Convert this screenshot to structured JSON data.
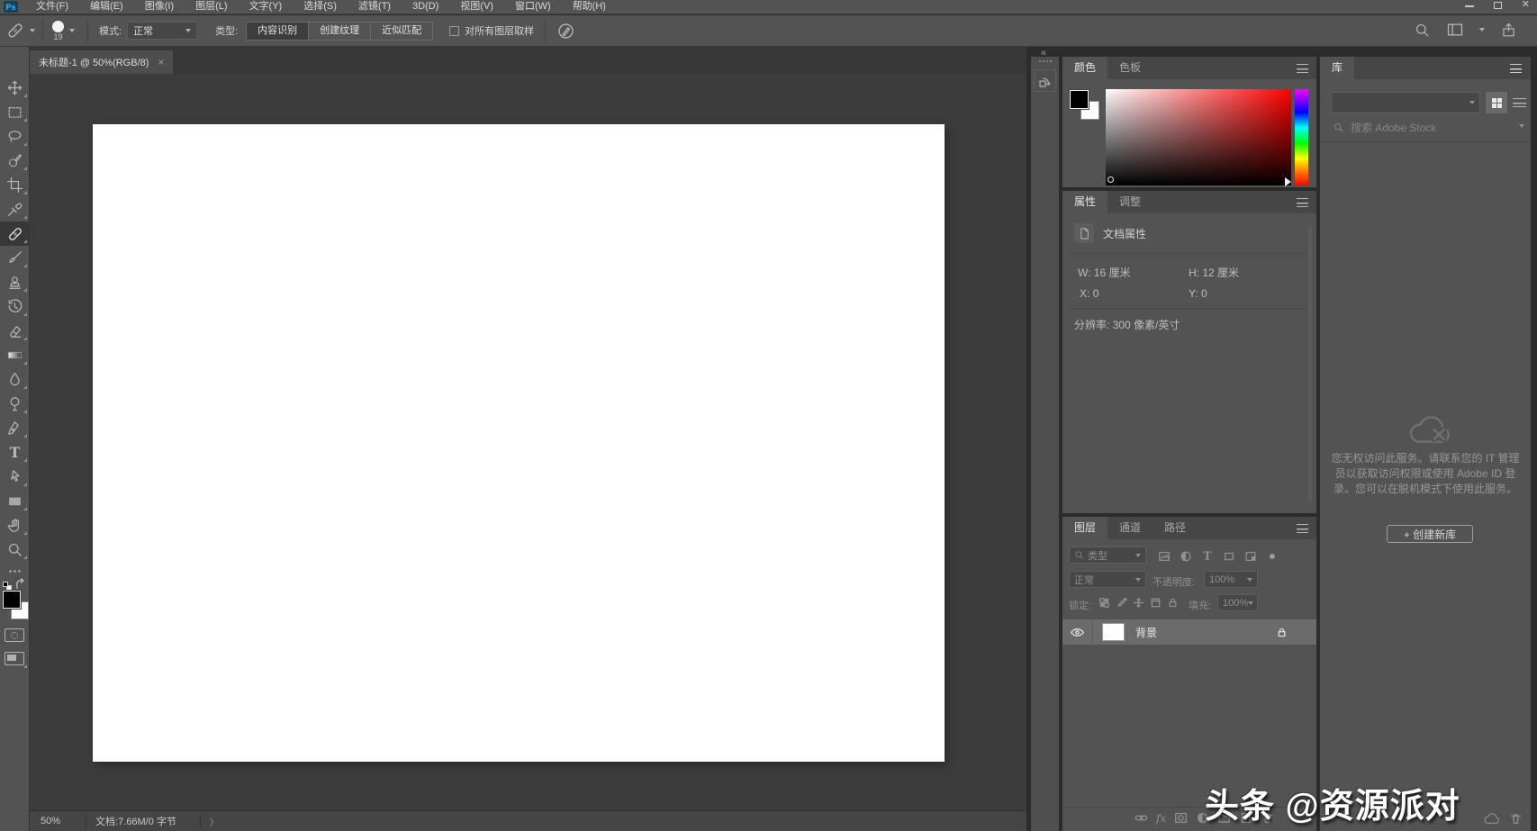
{
  "app": {
    "name": "Adobe Photoshop",
    "theme_colors": {
      "chrome": "#535353",
      "canvas_area": "#3c3c3c",
      "tab_strip": "#383838",
      "selected_layer": "#6b6b6b",
      "hue": "#ff0000",
      "logo_blue": "#4db3f0"
    }
  },
  "window_controls": [
    "minimize-button",
    "maximize-button",
    "close-button"
  ],
  "menu_bar": {
    "logo": "Ps",
    "items": [
      {
        "label": "文件(F)"
      },
      {
        "label": "编辑(E)"
      },
      {
        "label": "图像(I)"
      },
      {
        "label": "图层(L)"
      },
      {
        "label": "文字(Y)"
      },
      {
        "label": "选择(S)"
      },
      {
        "label": "滤镜(T)"
      },
      {
        "label": "3D(D)"
      },
      {
        "label": "视图(V)"
      },
      {
        "label": "窗口(W)"
      },
      {
        "label": "帮助(H)"
      }
    ]
  },
  "options_bar": {
    "tool_preset_icon": "spot-healing-brush-icon",
    "brush_size": "19",
    "mode_label": "模式:",
    "mode_value": "正常",
    "type_label": "类型:",
    "type_buttons": [
      {
        "label": "内容识别",
        "active": true
      },
      {
        "label": "创建纹理",
        "active": false
      },
      {
        "label": "近似匹配",
        "active": false
      }
    ],
    "sample_all_layers": {
      "checked": false,
      "label": "对所有图层取样"
    },
    "right_icons": [
      "search-icon",
      "workspace-switcher-icon",
      "share-icon"
    ]
  },
  "document_tab": {
    "title": "未标题-1 @ 50%(RGB/8)",
    "close_glyph": "×"
  },
  "toolbar": {
    "selected_tool": "spot-healing-brush-tool",
    "tools": [
      "move-tool",
      "rectangular-marquee-tool",
      "lasso-tool",
      "quick-selection-tool",
      "crop-tool",
      "eyedropper-tool",
      "spot-healing-brush-tool",
      "brush-tool",
      "clone-stamp-tool",
      "history-brush-tool",
      "eraser-tool",
      "gradient-tool",
      "blur-tool",
      "dodge-tool",
      "pen-tool",
      "horizontal-type-tool",
      "path-selection-tool",
      "rectangle-tool",
      "hand-tool",
      "zoom-tool"
    ],
    "foreground_color": "#000000",
    "background_color": "#ffffff"
  },
  "panels": {
    "collapsed_dock_icons": [
      "history-panel-icon"
    ],
    "color": {
      "tabs": [
        {
          "label": "颜色",
          "active": true
        },
        {
          "label": "色板",
          "active": false
        }
      ],
      "foreground": "#000000",
      "background": "#ffffff",
      "hue": "#ff0000"
    },
    "properties": {
      "tabs": [
        {
          "label": "属性",
          "active": true
        },
        {
          "label": "调整",
          "active": false
        }
      ],
      "section_title": "文档属性",
      "w_label": "W:",
      "w_value": "16 厘米",
      "h_label": "H:",
      "h_value": "12 厘米",
      "x_label": "X:",
      "x_value": "0",
      "y_label": "Y:",
      "y_value": "0",
      "resolution_label": "分辨率:",
      "resolution_value": "300 像素/英寸"
    },
    "layers": {
      "tabs": [
        {
          "label": "图层",
          "active": true
        },
        {
          "label": "通道",
          "active": false
        },
        {
          "label": "路径",
          "active": false
        }
      ],
      "filter_label": "类型",
      "blend_mode": "正常",
      "opacity_label": "不透明度:",
      "opacity_value": "100%",
      "lock_label": "锁定:",
      "fill_label": "填充:",
      "fill_value": "100%",
      "rows": [
        {
          "name": "背景",
          "visible": true,
          "locked": true,
          "selected": true,
          "thumbnail_color": "#ffffff"
        }
      ]
    },
    "library": {
      "tab": "库",
      "search_placeholder": "搜索 Adobe Stock",
      "offline_message": "您无权访问此服务。请联系您的 IT 管理员以获取访问权限或使用 Adobe ID 登录。您可以在脱机模式下使用此服务。",
      "create_button_label": "+ 创建新库"
    }
  },
  "status_bar": {
    "zoom_value": "50%",
    "doc_info": "文档:7.66M/0 字节"
  },
  "watermark": "头条 @资源派对"
}
